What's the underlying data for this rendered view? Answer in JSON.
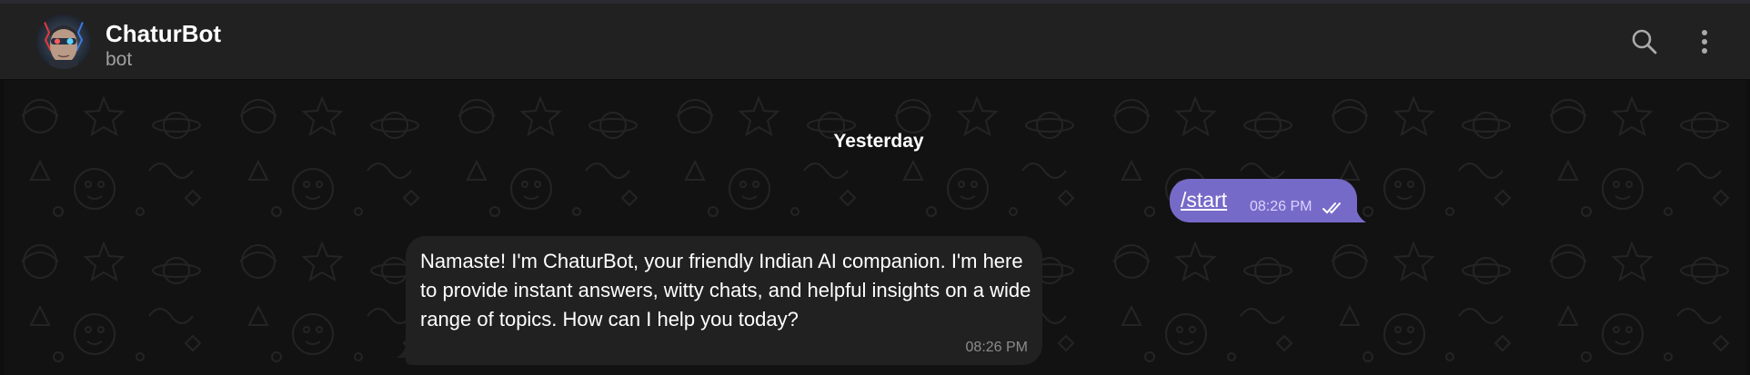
{
  "header": {
    "title": "ChaturBot",
    "status": "bot",
    "avatar_icon": "robot-face-avatar",
    "actions": [
      "search-icon",
      "more-vertical-icon"
    ]
  },
  "chat": {
    "date_separator": "Yesterday",
    "messages": [
      {
        "direction": "outgoing",
        "text": "/start",
        "time": "08:26 PM",
        "read_icon": "double-check-icon"
      },
      {
        "direction": "incoming",
        "text": "Namaste! I'm ChaturBot, your friendly Indian AI companion. I'm here to provide instant answers, witty chats, and helpful insights on a wide range of topics. How can I help you today?",
        "time": "08:26 PM"
      }
    ]
  },
  "colors": {
    "header_bg": "#212121",
    "chat_bg": "#121212",
    "outgoing_bubble": "#766ac8",
    "incoming_bubble": "#212121"
  }
}
